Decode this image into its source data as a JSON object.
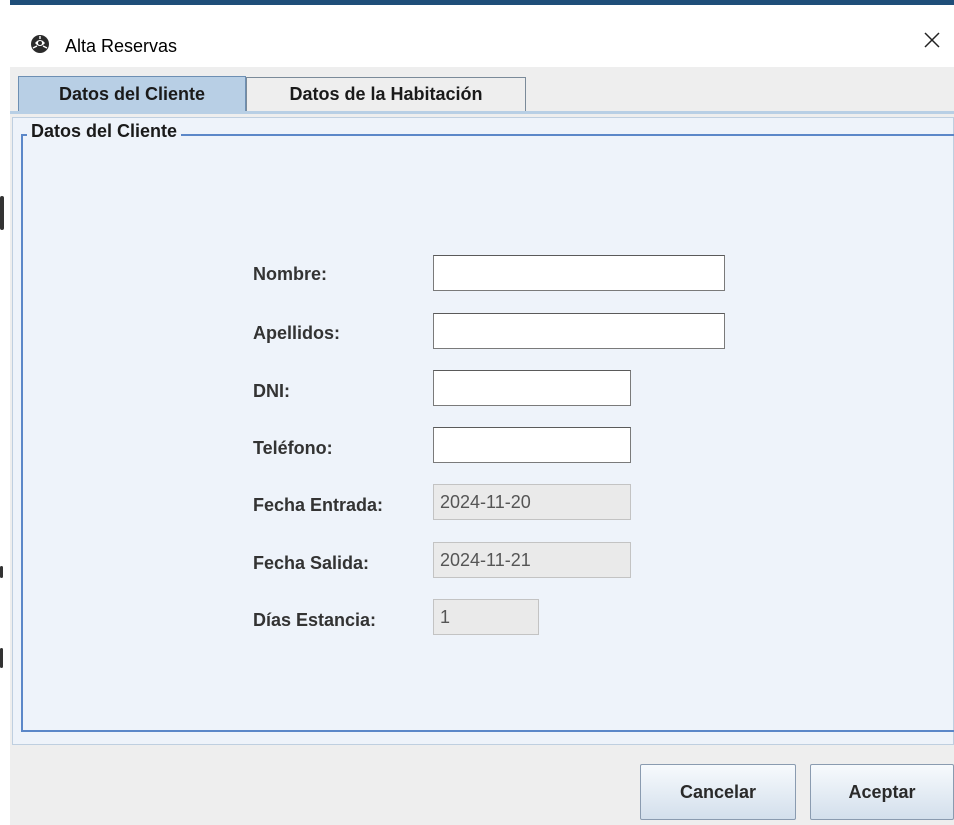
{
  "window": {
    "title": "Alta Reservas",
    "app_icon": "java-cup-icon",
    "close_icon": "close-icon"
  },
  "tabs": [
    {
      "label": "Datos del Cliente",
      "active": true
    },
    {
      "label": "Datos de la Habitación",
      "active": false
    }
  ],
  "panel": {
    "legend": "Datos del Cliente",
    "fields": {
      "nombre": {
        "label": "Nombre:",
        "value": ""
      },
      "apellidos": {
        "label": "Apellidos:",
        "value": ""
      },
      "dni": {
        "label": "DNI:",
        "value": ""
      },
      "telefono": {
        "label": "Teléfono:",
        "value": ""
      },
      "fecha_entrada": {
        "label": "Fecha Entrada:",
        "value": "2024-11-20"
      },
      "fecha_salida": {
        "label": "Fecha Salida:",
        "value": "2024-11-21"
      },
      "dias_estancia": {
        "label": "Días Estancia:",
        "value": "1"
      }
    }
  },
  "buttons": {
    "cancel": "Cancelar",
    "accept": "Aceptar"
  },
  "colors": {
    "tab_active": "#b8cfe5",
    "border_accent": "#5b87c8",
    "panel_bg": "#eef3fa"
  }
}
